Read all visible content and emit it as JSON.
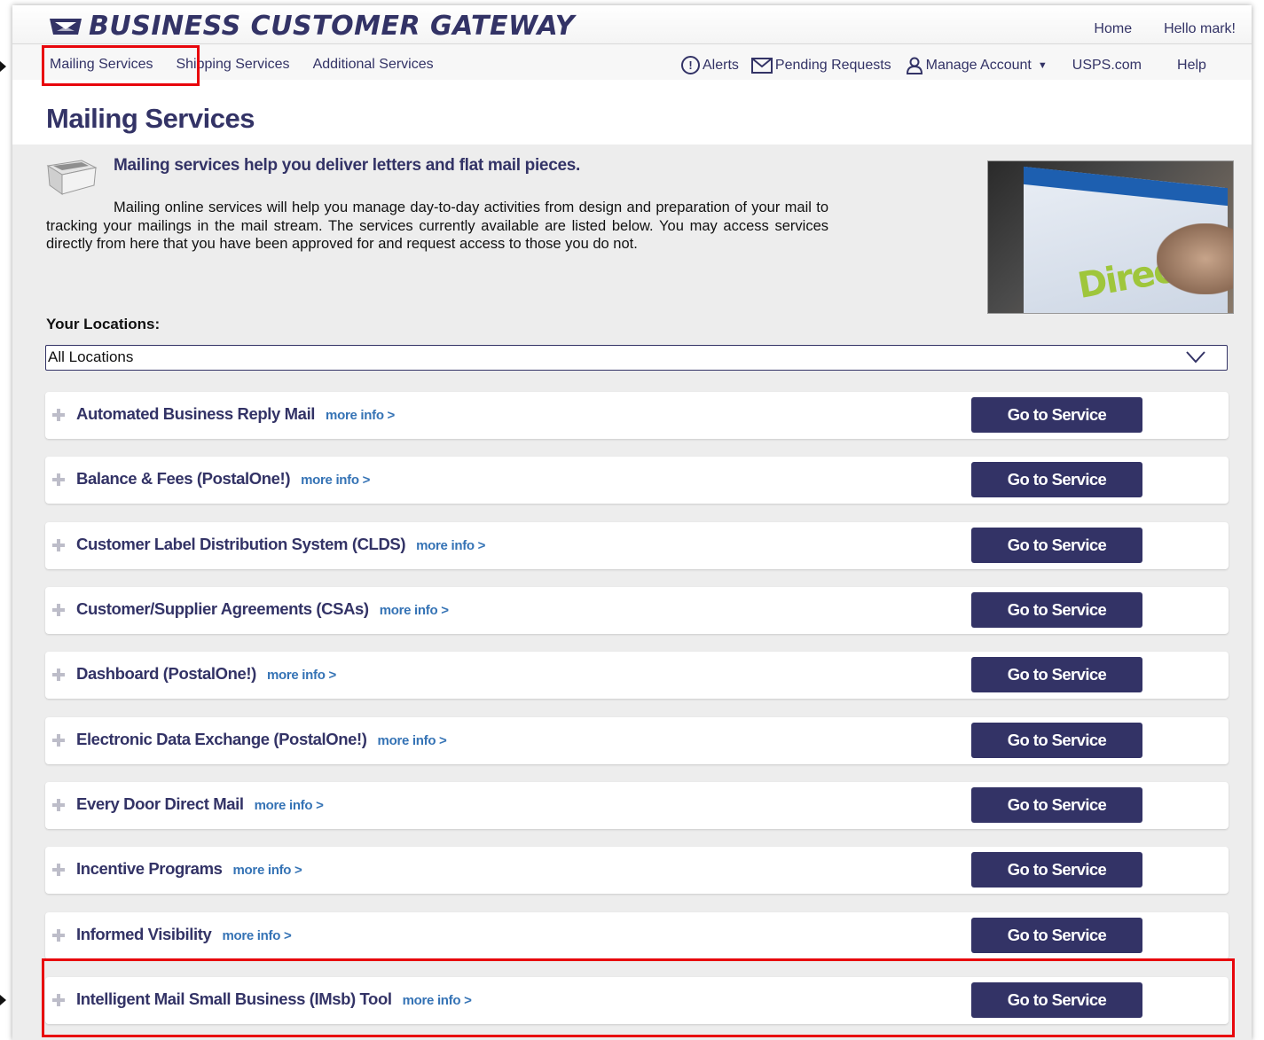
{
  "header": {
    "logo_text": "BUSINESS CUSTOMER GATEWAY",
    "top_links": [
      "Home",
      "Hello mark!"
    ]
  },
  "nav": {
    "left": [
      "Mailing Services",
      "Shipping Services",
      "Additional Services"
    ],
    "alerts": "Alerts",
    "pending": "Pending Requests",
    "manage": "Manage Account",
    "usps": "USPS.com",
    "help": "Help"
  },
  "page": {
    "title": "Mailing Services",
    "intro_heading": "Mailing services help you deliver letters and flat mail pieces.",
    "intro_text": "Mailing online services will help you manage day-to-day activities from design and preparation of your mail to tracking your mailings in the mail stream. The services currently available are listed below. You may access services directly from here that you have been approved for and request access to those you do not.",
    "photo_text": "DirectMail",
    "locations_label": "Your Locations:",
    "locations_value": "All Locations"
  },
  "services": [
    {
      "name": "Automated Business Reply Mail",
      "more": "more info >",
      "button": "Go to Service"
    },
    {
      "name": "Balance & Fees (PostalOne!)",
      "more": "more info >",
      "button": "Go to Service"
    },
    {
      "name": "Customer Label Distribution System (CLDS)",
      "more": "more info >",
      "button": "Go to Service"
    },
    {
      "name": "Customer/Supplier Agreements (CSAs)",
      "more": "more info >",
      "button": "Go to Service"
    },
    {
      "name": "Dashboard (PostalOne!)",
      "more": "more info >",
      "button": "Go to Service"
    },
    {
      "name": "Electronic Data Exchange (PostalOne!)",
      "more": "more info >",
      "button": "Go to Service"
    },
    {
      "name": "Every Door Direct Mail",
      "more": "more info >",
      "button": "Go to Service"
    },
    {
      "name": "Incentive Programs",
      "more": "more info >",
      "button": "Go to Service"
    },
    {
      "name": "Informed Visibility",
      "more": "more info >",
      "button": "Go to Service"
    },
    {
      "name": "Intelligent Mail Small Business (IMsb) Tool",
      "more": "more info >",
      "button": "Go to Service"
    }
  ],
  "colors": {
    "brand": "#333366",
    "link": "#3573b5",
    "highlight": "#e8060c"
  }
}
